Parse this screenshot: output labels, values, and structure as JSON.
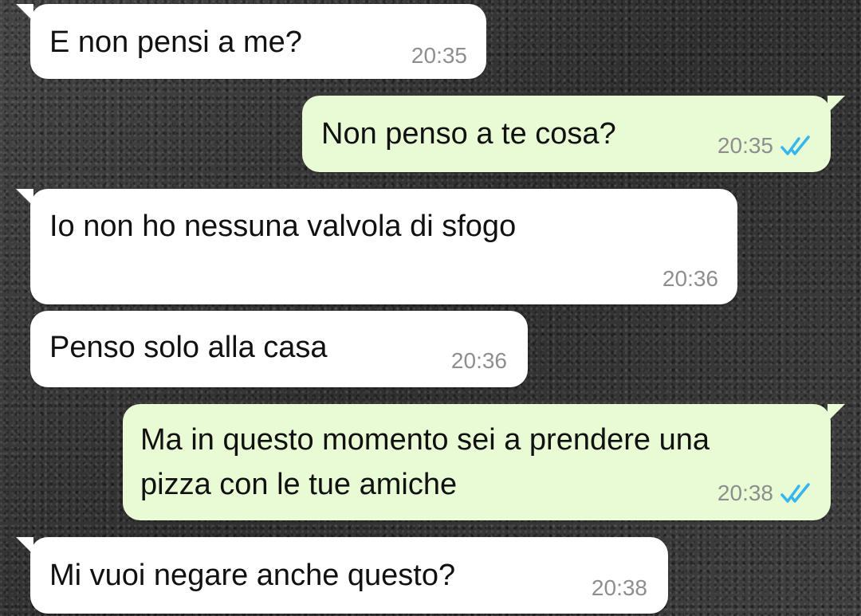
{
  "colors": {
    "incoming_bubble": "#ffffff",
    "outgoing_bubble": "#e8fbd4",
    "read_ticks": "#34b7f1",
    "timestamp": "#8e8e8e"
  },
  "messages": [
    {
      "direction": "in",
      "text": "E non pensi a me?",
      "time": "20:35"
    },
    {
      "direction": "out",
      "text": "Non penso a te cosa?",
      "time": "20:35",
      "status_icon": "double-check-icon"
    },
    {
      "direction": "in",
      "text": "Io non ho nessuna valvola di sfogo",
      "time": "20:36"
    },
    {
      "direction": "in",
      "text": "Penso solo alla casa",
      "time": "20:36"
    },
    {
      "direction": "out",
      "text": "Ma in questo momento sei a prendere una\npizza con le tue amiche",
      "time": "20:38",
      "status_icon": "double-check-icon"
    },
    {
      "direction": "in",
      "text": "Mi vuoi negare anche questo?",
      "time": "20:38"
    }
  ]
}
